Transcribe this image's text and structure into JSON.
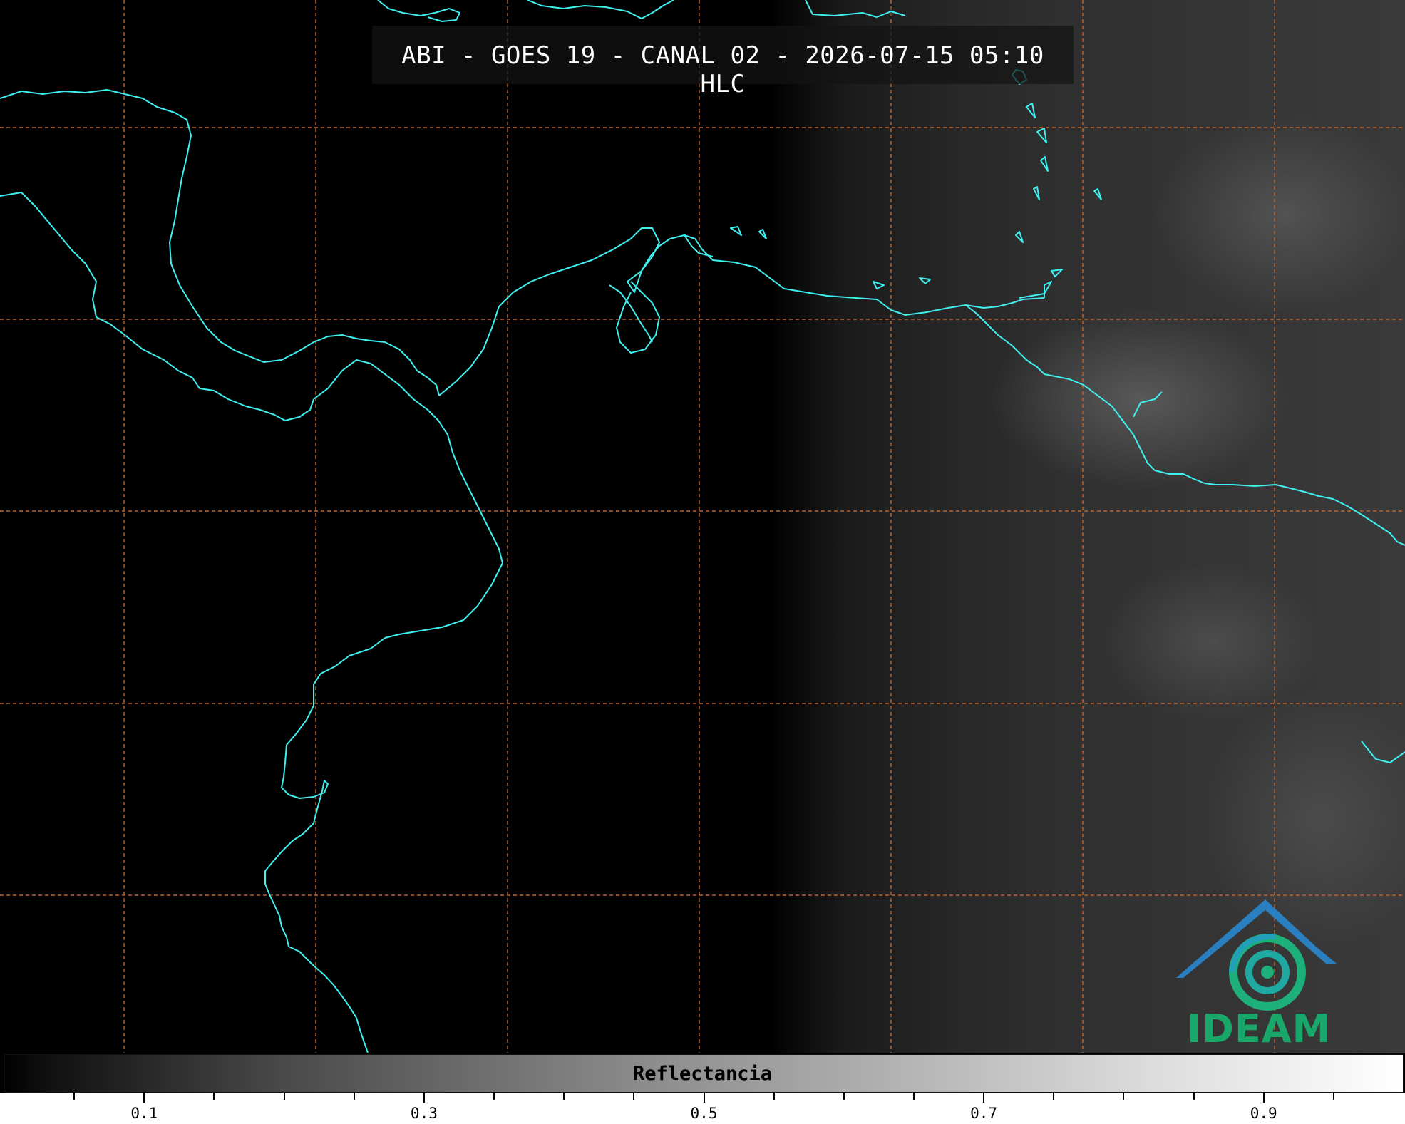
{
  "title": "ABI - GOES 19 - CANAL 02 - 2026-07-15 05:10 HLC",
  "logo": {
    "text": "IDEAM",
    "icon": "ideam-logo-icon"
  },
  "colorbar": {
    "label": "Reflectancia",
    "tick_labels": [
      "0.1",
      "0.3",
      "0.5",
      "0.7",
      "0.9"
    ],
    "range": [
      0.0,
      1.0
    ]
  },
  "colors": {
    "coastline": "#3ff0f0",
    "grid": "#c0642a",
    "background": "#000000"
  }
}
